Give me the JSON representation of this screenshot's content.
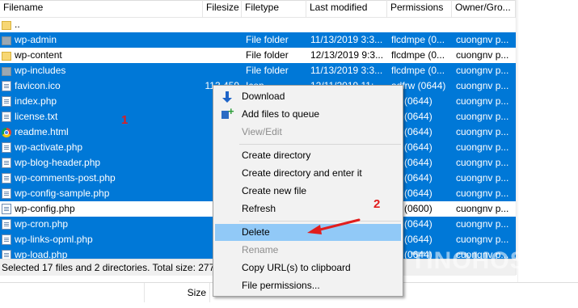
{
  "header": {
    "columns": [
      "Filename",
      "Filesize",
      "Filetype",
      "Last modified",
      "Permissions",
      "Owner/Gro..."
    ]
  },
  "rows": [
    {
      "name": "..",
      "size": "",
      "type": "",
      "modified": "",
      "perms": "",
      "owner": "",
      "icon": "folder-icon",
      "selected": false
    },
    {
      "name": "wp-admin",
      "size": "",
      "type": "File folder",
      "modified": "11/13/2019 3:3...",
      "perms": "flcdmpe (0...",
      "owner": "cuongnv p...",
      "icon": "folder-icon",
      "selected": true
    },
    {
      "name": "wp-content",
      "size": "",
      "type": "File folder",
      "modified": "12/13/2019 9:3...",
      "perms": "flcdmpe (0...",
      "owner": "cuongnv p...",
      "icon": "folder-icon",
      "selected": false
    },
    {
      "name": "wp-includes",
      "size": "",
      "type": "File folder",
      "modified": "11/13/2019 3:3...",
      "perms": "flcdmpe (0...",
      "owner": "cuongnv p...",
      "icon": "folder-icon",
      "selected": true
    },
    {
      "name": "favicon.ico",
      "size": "113,459",
      "type": "Icon",
      "modified": "12/11/2019 11:...",
      "perms": "adfrw (0644)",
      "owner": "cuongnv p...",
      "icon": "file-icon",
      "selected": true
    },
    {
      "name": "index.php",
      "size": "",
      "type": "",
      "modified": "",
      "perms": "rw (0644)",
      "owner": "cuongnv p...",
      "icon": "file-icon",
      "selected": true
    },
    {
      "name": "license.txt",
      "size": "1",
      "type": "",
      "modified": "",
      "perms": "rw (0644)",
      "owner": "cuongnv p...",
      "icon": "file-icon",
      "selected": true
    },
    {
      "name": "readme.html",
      "size": "",
      "type": "",
      "modified": "",
      "perms": "rw (0644)",
      "owner": "cuongnv p...",
      "icon": "chrome-icon",
      "selected": true
    },
    {
      "name": "wp-activate.php",
      "size": "",
      "type": "",
      "modified": "",
      "perms": "rw (0644)",
      "owner": "cuongnv p...",
      "icon": "file-icon",
      "selected": true
    },
    {
      "name": "wp-blog-header.php",
      "size": "",
      "type": "",
      "modified": "",
      "perms": "rw (0644)",
      "owner": "cuongnv p...",
      "icon": "file-icon",
      "selected": true
    },
    {
      "name": "wp-comments-post.php",
      "size": "",
      "type": "",
      "modified": "",
      "perms": "rw (0644)",
      "owner": "cuongnv p...",
      "icon": "file-icon",
      "selected": true
    },
    {
      "name": "wp-config-sample.php",
      "size": "",
      "type": "",
      "modified": "",
      "perms": "rw (0644)",
      "owner": "cuongnv p...",
      "icon": "file-icon",
      "selected": true
    },
    {
      "name": "wp-config.php",
      "size": "",
      "type": "",
      "modified": "",
      "perms": "rw (0600)",
      "owner": "cuongnv p...",
      "icon": "file-icon",
      "selected": false
    },
    {
      "name": "wp-cron.php",
      "size": "",
      "type": "",
      "modified": "",
      "perms": "rw (0644)",
      "owner": "cuongnv p...",
      "icon": "file-icon",
      "selected": true
    },
    {
      "name": "wp-links-opml.php",
      "size": "",
      "type": "",
      "modified": "",
      "perms": "rw (0644)",
      "owner": "cuongnv p...",
      "icon": "file-icon",
      "selected": true
    },
    {
      "name": "wp-load.php",
      "size": "",
      "type": "",
      "modified": "",
      "perms": "rw (0644)",
      "owner": "cuongnv p...",
      "icon": "file-icon",
      "selected": true
    }
  ],
  "status": {
    "text": "Selected 17 files and 2 directories. Total size: 277,09"
  },
  "bottom_header": {
    "size_label": "Size"
  },
  "context_menu": {
    "items": [
      {
        "label": "Download",
        "icon": "download-icon",
        "disabled": false,
        "highlighted": false
      },
      {
        "label": "Add files to queue",
        "icon": "add-queue-icon",
        "disabled": false,
        "highlighted": false
      },
      {
        "label": "View/Edit",
        "icon": "",
        "disabled": true,
        "highlighted": false
      },
      {
        "label": "Create directory",
        "icon": "",
        "disabled": false,
        "highlighted": false
      },
      {
        "label": "Create directory and enter it",
        "icon": "",
        "disabled": false,
        "highlighted": false
      },
      {
        "label": "Create new file",
        "icon": "",
        "disabled": false,
        "highlighted": false
      },
      {
        "label": "Refresh",
        "icon": "",
        "disabled": false,
        "highlighted": false
      },
      {
        "label": "Delete",
        "icon": "",
        "disabled": false,
        "highlighted": true
      },
      {
        "label": "Rename",
        "icon": "",
        "disabled": true,
        "highlighted": false
      },
      {
        "label": "Copy URL(s) to clipboard",
        "icon": "",
        "disabled": false,
        "highlighted": false
      },
      {
        "label": "File permissions...",
        "icon": "",
        "disabled": false,
        "highlighted": false
      }
    ]
  },
  "annotations": {
    "step1": "1",
    "step2": "2"
  },
  "watermark": {
    "text": "TINOHOST"
  },
  "colors": {
    "selection": "#0078d7",
    "menu_highlight": "#91c9f7",
    "annotation": "#e11d1d"
  }
}
